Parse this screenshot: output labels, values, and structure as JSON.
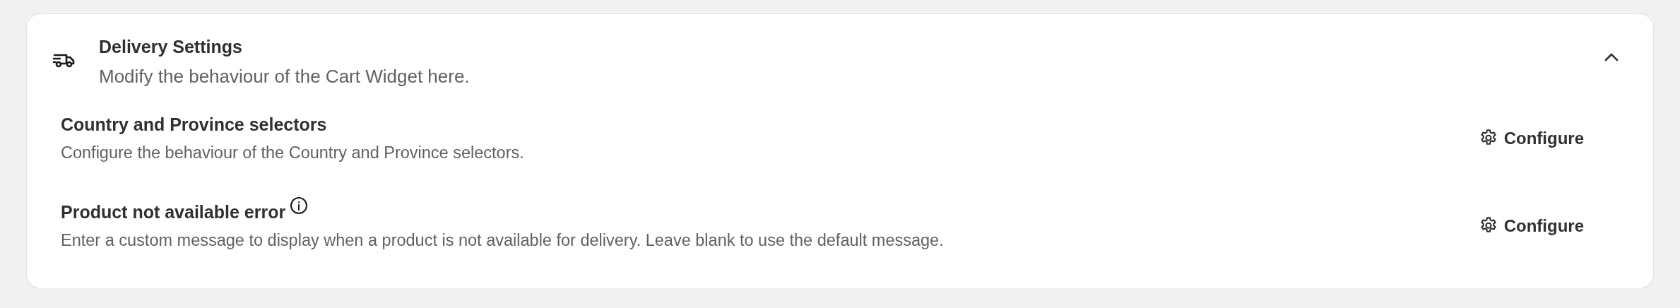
{
  "section": {
    "title": "Delivery Settings",
    "subtitle": "Modify the behaviour of the Cart Widget here.",
    "expanded": true,
    "settings": [
      {
        "title": "Country and Province selectors",
        "info": false,
        "description": "Configure the behaviour of the Country and Province selectors.",
        "action": "Configure"
      },
      {
        "title": "Product not available error",
        "info": true,
        "description": "Enter a custom message to display when a product is not available for delivery. Leave blank to use the default message.",
        "action": "Configure"
      }
    ]
  }
}
